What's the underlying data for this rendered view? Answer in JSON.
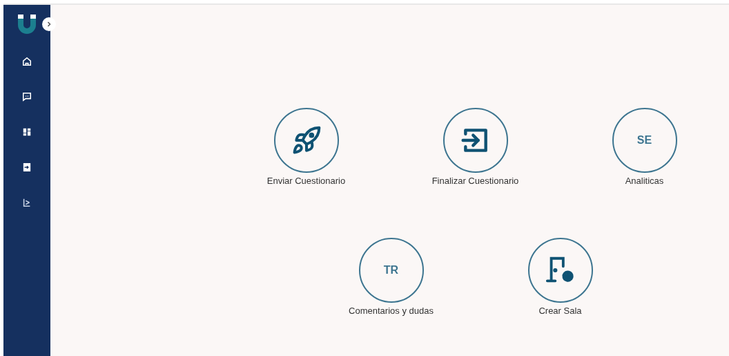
{
  "tile_rows": [
    [
      {
        "kind": "rocket",
        "label": "Enviar Cuestionario"
      },
      {
        "kind": "enter",
        "label": "Finalizar Cuestionario"
      },
      {
        "kind": "initials",
        "initials": "SE",
        "label": "Analiticas"
      }
    ],
    [
      {
        "kind": "initials",
        "initials": "TR",
        "label": "Comentarios y dudas"
      },
      {
        "kind": "room",
        "label": "Crear Sala"
      }
    ]
  ]
}
